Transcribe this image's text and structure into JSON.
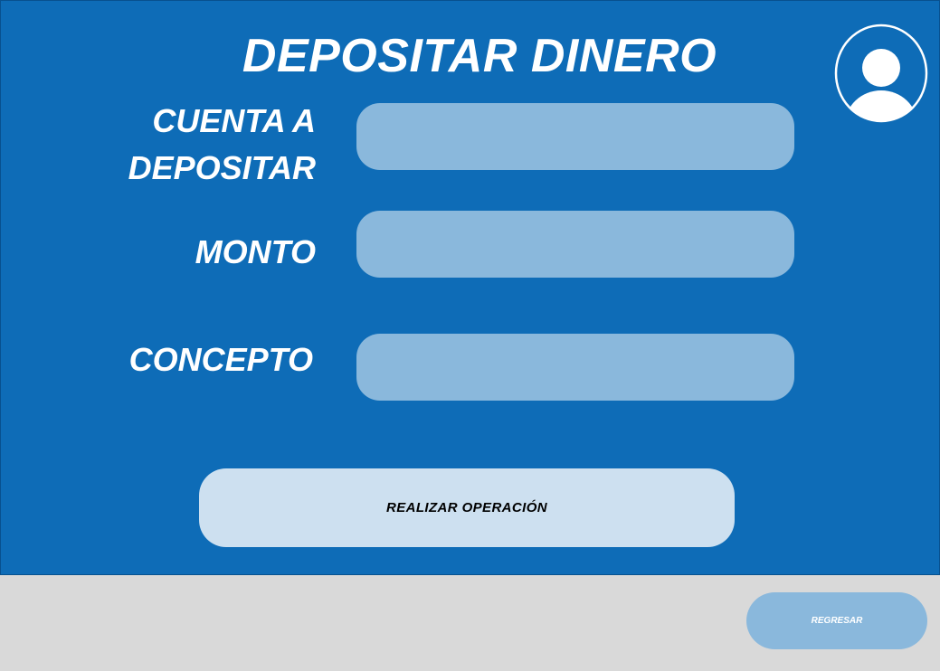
{
  "page": {
    "title": "DEPOSITAR DINERO"
  },
  "form": {
    "cuenta": {
      "label": "CUENTA A\nDEPOSITAR",
      "value": "",
      "placeholder": ""
    },
    "monto": {
      "label": "MONTO",
      "value": "",
      "placeholder": ""
    },
    "concepto": {
      "label": "CONCEPTO",
      "value": "",
      "placeholder": ""
    }
  },
  "actions": {
    "submit_label": "REALIZAR OPERACIÓN",
    "back_label": "REGRESAR"
  },
  "icons": {
    "profile": "user-avatar-icon"
  },
  "colors": {
    "panel_background": "#0e6cb7",
    "footer_background": "#d9d9d9",
    "input_background": "#8ab8dc",
    "primary_button_background": "#cde0f0",
    "text_light": "#ffffff"
  }
}
